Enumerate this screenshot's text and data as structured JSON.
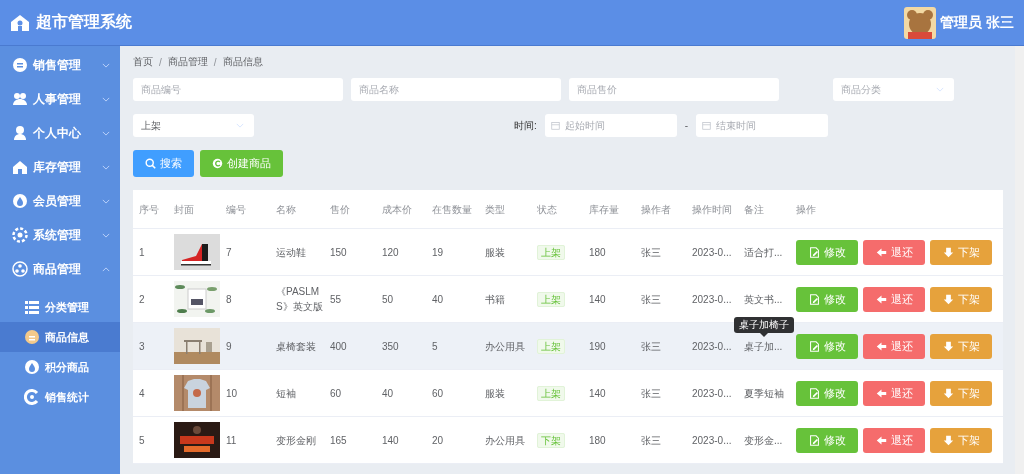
{
  "header": {
    "title": "超市管理系统",
    "user": "管理员 张三"
  },
  "sidebar": {
    "items": [
      {
        "label": "销售管理",
        "expanded": false
      },
      {
        "label": "人事管理",
        "expanded": false
      },
      {
        "label": "个人中心",
        "expanded": false
      },
      {
        "label": "库存管理",
        "expanded": false
      },
      {
        "label": "会员管理",
        "expanded": false
      },
      {
        "label": "系统管理",
        "expanded": false
      },
      {
        "label": "商品管理",
        "expanded": true,
        "children": [
          {
            "label": "分类管理",
            "selected": false
          },
          {
            "label": "商品信息",
            "selected": true
          },
          {
            "label": "积分商品",
            "selected": false
          },
          {
            "label": "销售统计",
            "selected": false
          }
        ]
      }
    ]
  },
  "breadcrumb": {
    "separator": "/",
    "items": [
      "首页",
      "商品管理",
      "商品信息"
    ]
  },
  "filters": {
    "code": {
      "placeholder": "商品编号"
    },
    "name": {
      "placeholder": "商品名称"
    },
    "price": {
      "placeholder": "商品售价"
    },
    "category": {
      "placeholder": "商品分类"
    },
    "status": {
      "value": "上架"
    },
    "time": {
      "label": "时间:",
      "start": {
        "placeholder": "起始时间"
      },
      "separator": "-",
      "end": {
        "placeholder": "结束时间"
      }
    }
  },
  "actions": [
    {
      "kind": "search",
      "label": "搜索"
    },
    {
      "kind": "create",
      "label": "创建商品"
    }
  ],
  "table": {
    "columns": [
      "序号",
      "封面",
      "编号",
      "名称",
      "售价",
      "成本价",
      "在售数量",
      "类型",
      "状态",
      "库存量",
      "操作者",
      "操作时间",
      "备注",
      "操作"
    ],
    "rows": [
      {
        "index": "1",
        "cover": {
          "kind": "picture"
        },
        "code": "7",
        "name": "运动鞋",
        "price": "150",
        "cost": "120",
        "on_sale": "19",
        "type": "服装",
        "status": "上架",
        "stock": "180",
        "operator": "张三",
        "time": "2023-0...",
        "remark": "适合打...",
        "highlighted": false,
        "actions": [
          {
            "kind": "edit",
            "label": "修改"
          },
          {
            "kind": "return",
            "label": "退还"
          },
          {
            "kind": "off",
            "label": "下架"
          }
        ]
      },
      {
        "index": "2",
        "cover": {
          "kind": "picture"
        },
        "code": "8",
        "name": "《PASLMS》英文版",
        "price": "55",
        "cost": "50",
        "on_sale": "40",
        "type": "书籍",
        "status": "上架",
        "stock": "140",
        "operator": "张三",
        "time": "2023-0...",
        "remark": "英文书...",
        "highlighted": false,
        "actions": [
          {
            "kind": "edit",
            "label": "修改"
          },
          {
            "kind": "return",
            "label": "退还"
          },
          {
            "kind": "off",
            "label": "下架"
          }
        ]
      },
      {
        "index": "3",
        "cover": {
          "kind": "picture"
        },
        "code": "9",
        "name": "桌椅套装",
        "price": "400",
        "cost": "350",
        "on_sale": "5",
        "type": "办公用具",
        "status": "上架",
        "stock": "190",
        "operator": "张三",
        "time": "2023-0...",
        "remark": "桌子加...",
        "highlighted": true,
        "tooltip": "桌子加椅子",
        "actions": [
          {
            "kind": "edit",
            "label": "修改"
          },
          {
            "kind": "return",
            "label": "退还"
          },
          {
            "kind": "off",
            "label": "下架"
          }
        ]
      },
      {
        "index": "4",
        "cover": {
          "kind": "picture"
        },
        "code": "10",
        "name": "短袖",
        "price": "60",
        "cost": "40",
        "on_sale": "60",
        "type": "服装",
        "status": "上架",
        "stock": "140",
        "operator": "张三",
        "time": "2023-0...",
        "remark": "夏季短袖",
        "highlighted": false,
        "actions": [
          {
            "kind": "edit",
            "label": "修改"
          },
          {
            "kind": "return",
            "label": "退还"
          },
          {
            "kind": "off",
            "label": "下架"
          }
        ]
      },
      {
        "index": "5",
        "cover": {
          "kind": "picture"
        },
        "code": "11",
        "name": "变形金刚",
        "price": "165",
        "cost": "140",
        "on_sale": "20",
        "type": "办公用具",
        "status": "下架",
        "stock": "180",
        "operator": "张三",
        "time": "2023-0...",
        "remark": "变形金...",
        "highlighted": false,
        "actions": [
          {
            "kind": "edit",
            "label": "修改"
          },
          {
            "kind": "return",
            "label": "退还"
          },
          {
            "kind": "off",
            "label": "下架"
          }
        ]
      }
    ]
  }
}
